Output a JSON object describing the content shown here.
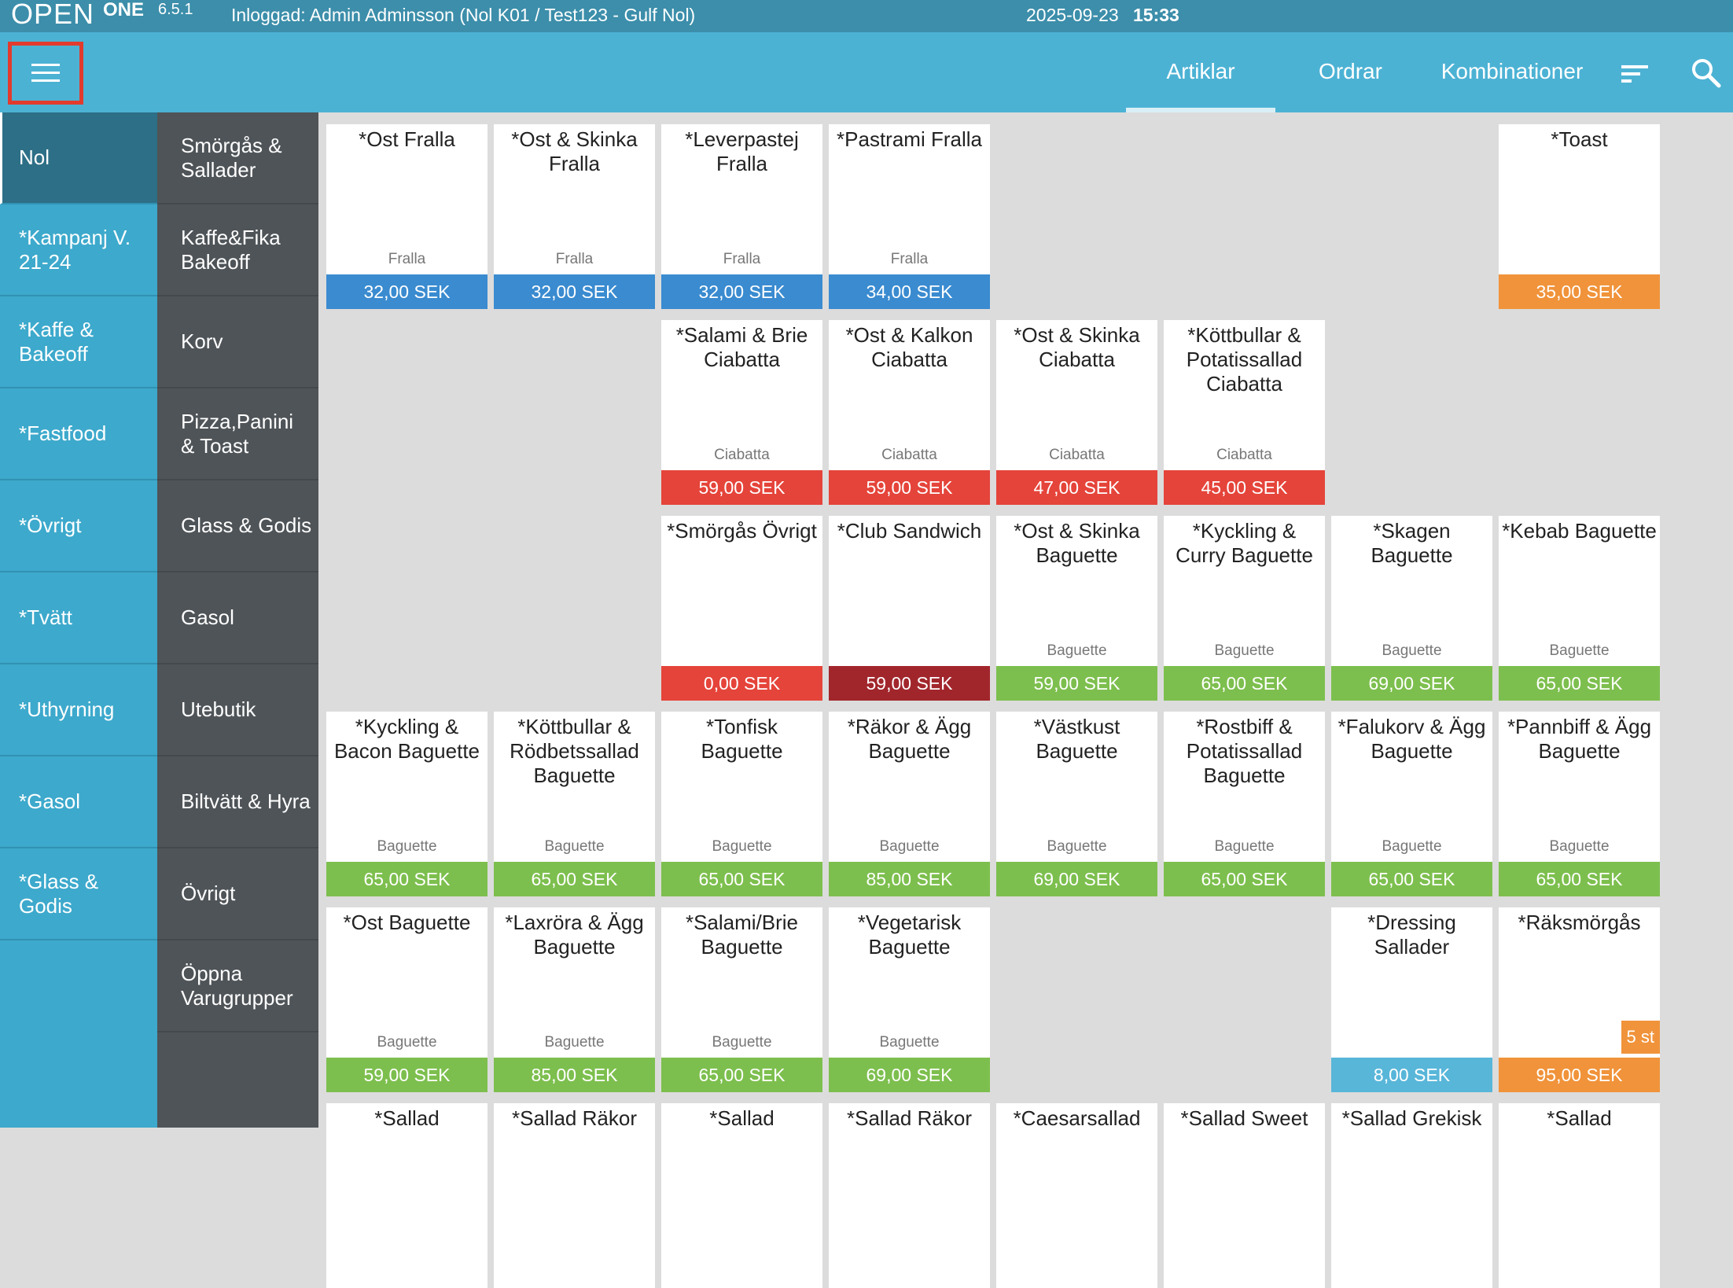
{
  "topbar": {
    "logo_text": "OPEN",
    "logo_one": "ONE",
    "version": "6.5.1",
    "login": "Inloggad: Admin Adminsson (Nol K01 / Test123 - Gulf Nol)",
    "date": "2025-09-23",
    "time": "15:33"
  },
  "nav": {
    "tabs": [
      "Artiklar",
      "Ordrar",
      "Kombinationer"
    ],
    "active_tab": "Artiklar"
  },
  "colors": {
    "topbar": "#3c8eaa",
    "navbar": "#4cb2d4",
    "price_blue": "#3a8bd0",
    "price_orange": "#f0933a",
    "price_red": "#e5443a",
    "price_darkred": "#a1262c",
    "price_green": "#7dbf4e",
    "price_lightblue": "#58b6d9"
  },
  "categories": [
    "Nol",
    "*Kampanj V. 21-24",
    "*Kaffe & Bakeoff",
    "*Fastfood",
    "*Övrigt",
    "*Tvätt",
    "*Uthyrning",
    "*Gasol",
    "*Glass & Godis"
  ],
  "subcategories": [
    "Smörgås & Sallader",
    "Kaffe&Fika Bakeoff",
    "Korv",
    "Pizza,Panini & Toast",
    "Glass & Godis",
    "Gasol",
    "Utebutik",
    "Biltvätt & Hyra",
    "Övrigt",
    "Öppna Varugrupper"
  ],
  "products": [
    {
      "name": "*Ost Fralla",
      "category": "Fralla",
      "price": "32,00 SEK",
      "color": "#3a8bd0",
      "row": 0,
      "col": 0
    },
    {
      "name": "*Ost & Skinka Fralla",
      "category": "Fralla",
      "price": "32,00 SEK",
      "color": "#3a8bd0",
      "row": 0,
      "col": 1
    },
    {
      "name": "*Leverpastej Fralla",
      "category": "Fralla",
      "price": "32,00 SEK",
      "color": "#3a8bd0",
      "row": 0,
      "col": 2
    },
    {
      "name": "*Pastrami Fralla",
      "category": "Fralla",
      "price": "34,00 SEK",
      "color": "#3a8bd0",
      "row": 0,
      "col": 3
    },
    {
      "name": "*Toast",
      "category": "",
      "price": "35,00 SEK",
      "color": "#f0933a",
      "row": 0,
      "col": 7
    },
    {
      "name": "*Salami & Brie Ciabatta",
      "category": "Ciabatta",
      "price": "59,00 SEK",
      "color": "#e5443a",
      "row": 1,
      "col": 2
    },
    {
      "name": "*Ost & Kalkon Ciabatta",
      "category": "Ciabatta",
      "price": "59,00 SEK",
      "color": "#e5443a",
      "row": 1,
      "col": 3
    },
    {
      "name": "*Ost & Skinka Ciabatta",
      "category": "Ciabatta",
      "price": "47,00 SEK",
      "color": "#e5443a",
      "row": 1,
      "col": 4
    },
    {
      "name": "*Köttbullar & Potatissallad Ciabatta",
      "category": "Ciabatta",
      "price": "45,00 SEK",
      "color": "#e5443a",
      "row": 1,
      "col": 5
    },
    {
      "name": "*Smörgås Övrigt",
      "category": "",
      "price": "0,00 SEK",
      "color": "#e5443a",
      "row": 2,
      "col": 2
    },
    {
      "name": "*Club Sandwich",
      "category": "",
      "price": "59,00 SEK",
      "color": "#a1262c",
      "row": 2,
      "col": 3
    },
    {
      "name": "*Ost & Skinka Baguette",
      "category": "Baguette",
      "price": "59,00 SEK",
      "color": "#7dbf4e",
      "row": 2,
      "col": 4
    },
    {
      "name": "*Kyckling & Curry Baguette",
      "category": "Baguette",
      "price": "65,00 SEK",
      "color": "#7dbf4e",
      "row": 2,
      "col": 5
    },
    {
      "name": "*Skagen Baguette",
      "category": "Baguette",
      "price": "69,00 SEK",
      "color": "#7dbf4e",
      "row": 2,
      "col": 6
    },
    {
      "name": "*Kebab Baguette",
      "category": "Baguette",
      "price": "65,00 SEK",
      "color": "#7dbf4e",
      "row": 2,
      "col": 7
    },
    {
      "name": "*Kyckling & Bacon Baguette",
      "category": "Baguette",
      "price": "65,00 SEK",
      "color": "#7dbf4e",
      "row": 3,
      "col": 0
    },
    {
      "name": "*Köttbullar & Rödbetssallad Baguette",
      "category": "Baguette",
      "price": "65,00 SEK",
      "color": "#7dbf4e",
      "row": 3,
      "col": 1
    },
    {
      "name": "*Tonfisk Baguette",
      "category": "Baguette",
      "price": "65,00 SEK",
      "color": "#7dbf4e",
      "row": 3,
      "col": 2
    },
    {
      "name": "*Räkor & Ägg Baguette",
      "category": "Baguette",
      "price": "85,00 SEK",
      "color": "#7dbf4e",
      "row": 3,
      "col": 3
    },
    {
      "name": "*Västkust Baguette",
      "category": "Baguette",
      "price": "69,00 SEK",
      "color": "#7dbf4e",
      "row": 3,
      "col": 4
    },
    {
      "name": "*Rostbiff & Potatissallad Baguette",
      "category": "Baguette",
      "price": "65,00 SEK",
      "color": "#7dbf4e",
      "row": 3,
      "col": 5
    },
    {
      "name": "*Falukorv & Ägg Baguette",
      "category": "Baguette",
      "price": "65,00 SEK",
      "color": "#7dbf4e",
      "row": 3,
      "col": 6
    },
    {
      "name": "*Pannbiff & Ägg Baguette",
      "category": "Baguette",
      "price": "65,00 SEK",
      "color": "#7dbf4e",
      "row": 3,
      "col": 7
    },
    {
      "name": "*Ost Baguette",
      "category": "Baguette",
      "price": "59,00 SEK",
      "color": "#7dbf4e",
      "row": 4,
      "col": 0
    },
    {
      "name": "*Laxröra & Ägg Baguette",
      "category": "Baguette",
      "price": "85,00 SEK",
      "color": "#7dbf4e",
      "row": 4,
      "col": 1
    },
    {
      "name": "*Salami/Brie Baguette",
      "category": "Baguette",
      "price": "65,00 SEK",
      "color": "#7dbf4e",
      "row": 4,
      "col": 2
    },
    {
      "name": "*Vegetarisk Baguette",
      "category": "Baguette",
      "price": "69,00 SEK",
      "color": "#7dbf4e",
      "row": 4,
      "col": 3
    },
    {
      "name": "*Dressing Sallader",
      "category": "",
      "price": "8,00 SEK",
      "color": "#58b6d9",
      "row": 4,
      "col": 6
    },
    {
      "name": "*Räksmörgås",
      "category": "",
      "price": "95,00 SEK",
      "color": "#f0933a",
      "row": 4,
      "col": 7,
      "badge": "5 st"
    },
    {
      "name": "*Sallad",
      "category": "",
      "price": "",
      "color": "#7dbf4e",
      "row": 5,
      "col": 0
    },
    {
      "name": "*Sallad Räkor",
      "category": "",
      "price": "",
      "color": "#7dbf4e",
      "row": 5,
      "col": 1
    },
    {
      "name": "*Sallad",
      "category": "",
      "price": "",
      "color": "#7dbf4e",
      "row": 5,
      "col": 2
    },
    {
      "name": "*Sallad Räkor",
      "category": "",
      "price": "",
      "color": "#7dbf4e",
      "row": 5,
      "col": 3
    },
    {
      "name": "*Caesarsallad",
      "category": "",
      "price": "",
      "color": "#7dbf4e",
      "row": 5,
      "col": 4
    },
    {
      "name": "*Sallad Sweet",
      "category": "",
      "price": "",
      "color": "#7dbf4e",
      "row": 5,
      "col": 5
    },
    {
      "name": "*Sallad Grekisk",
      "category": "",
      "price": "",
      "color": "#7dbf4e",
      "row": 5,
      "col": 6
    },
    {
      "name": "*Sallad",
      "category": "",
      "price": "",
      "color": "#7dbf4e",
      "row": 5,
      "col": 7
    }
  ]
}
